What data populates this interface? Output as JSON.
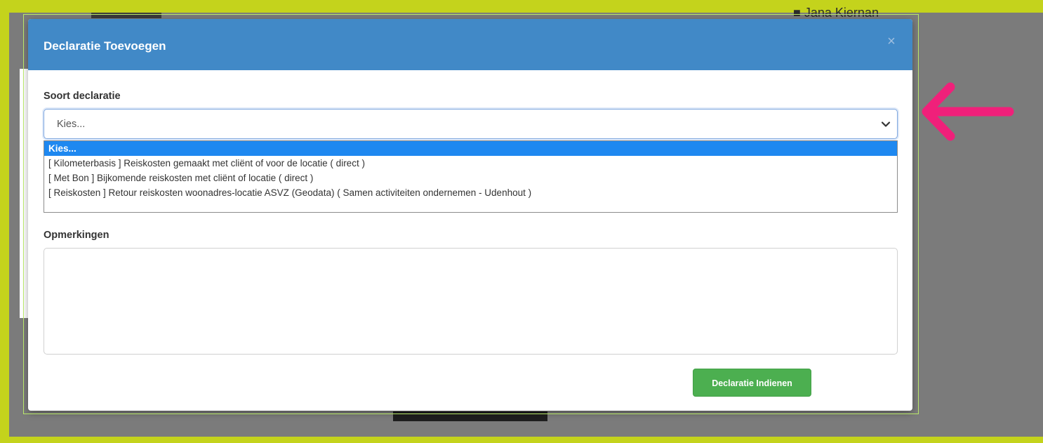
{
  "background": {
    "frame_color": "#c4d31c",
    "overlay_color": "#7b7b7b",
    "underlying_user_name": "■ Jana Kiernan"
  },
  "modal": {
    "title": "Declaratie Toevoegen",
    "header_color": "#4189c7",
    "close_icon": "close-icon",
    "close_glyph": "×"
  },
  "form": {
    "soort_label": "Soort declaratie",
    "select": {
      "selected_value": "Kies...",
      "options": [
        "Kies...",
        "[ Kilometerbasis ] Reiskosten gemaakt met cliënt of voor de locatie ( direct )",
        "[ Met Bon ] Bijkomende reiskosten met cliënt of locatie ( direct )",
        "[ Reiskosten ] Retour reiskosten woonadres-locatie ASVZ (Geodata) ( Samen activiteiten ondernemen - Udenhout )"
      ],
      "highlighted_index": 0,
      "highlight_color": "#1e88f0"
    },
    "opmerkingen_label": "Opmerkingen",
    "opmerkingen_value": "",
    "submit_label": "Declaratie Indienen",
    "submit_color": "#4caf50"
  },
  "annotation": {
    "arrow_color": "#f0207a",
    "arrow_icon": "arrow-left-icon"
  }
}
